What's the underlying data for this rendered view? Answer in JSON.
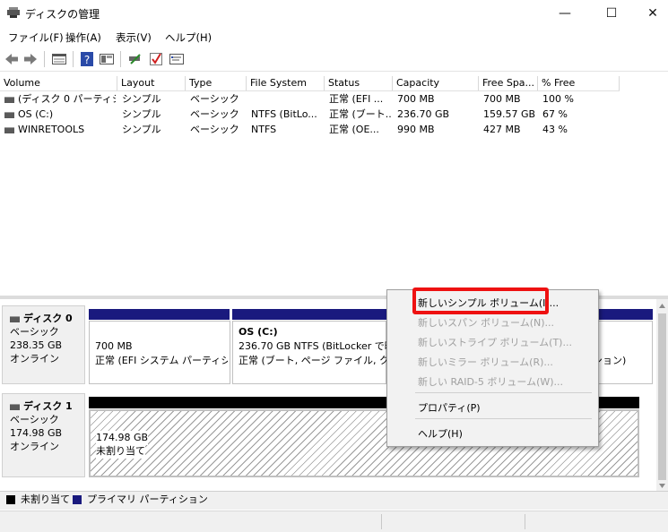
{
  "window": {
    "title": "ディスクの管理",
    "controls": {
      "minimize": "—",
      "maximize": "☐",
      "close": "✕"
    }
  },
  "menu": [
    "ファイル(F)",
    "操作(A)",
    "表示(V)",
    "ヘルプ(H)"
  ],
  "toolbar_icons": [
    "back-icon",
    "forward-icon",
    "disk-list-icon",
    "help-icon",
    "disk-view-icon",
    "connect-icon",
    "check-icon",
    "properties-icon"
  ],
  "columns": [
    "Volume",
    "Layout",
    "Type",
    "File System",
    "Status",
    "Capacity",
    "Free Spa...",
    "% Free"
  ],
  "volumes": [
    {
      "volume": "(ディスク 0 パーティシ...",
      "layout": "シンプル",
      "type": "ベーシック",
      "fs": "",
      "status": "正常 (EFI ...",
      "capacity": "700 MB",
      "free": "700 MB",
      "pct": "100 %"
    },
    {
      "volume": "OS (C:)",
      "layout": "シンプル",
      "type": "ベーシック",
      "fs": "NTFS (BitLo...",
      "status": "正常 (ブート...",
      "capacity": "236.70 GB",
      "free": "159.57 GB",
      "pct": "67 %"
    },
    {
      "volume": "WINRETOOLS",
      "layout": "シンプル",
      "type": "ベーシック",
      "fs": "NTFS",
      "status": "正常 (OE...",
      "capacity": "990 MB",
      "free": "427 MB",
      "pct": "43 %"
    }
  ],
  "disks": [
    {
      "name": "ディスク 0",
      "kind": "ベーシック",
      "size": "238.35 GB",
      "state": "オンライン",
      "partitions": [
        {
          "title": "",
          "line1": "700 MB",
          "line2": "正常 (EFI システム パーティション)"
        },
        {
          "title": "OS  (C:)",
          "line1": "236.70 GB NTFS (BitLocker で暗号化)",
          "line2": "正常 (ブート, ページ ファイル, クラッシュ ダンプ"
        },
        {
          "title": "",
          "line1": "",
          "line2": "ション)"
        }
      ]
    },
    {
      "name": "ディスク 1",
      "kind": "ベーシック",
      "size": "174.98 GB",
      "state": "オンライン",
      "partitions": [
        {
          "title": "",
          "line1": "174.98 GB",
          "line2": "未割り当て"
        }
      ]
    }
  ],
  "legend": [
    {
      "label": "未割り当て",
      "color": "#000000"
    },
    {
      "label": "プライマリ パーティション",
      "color": "#1a1a7e"
    }
  ],
  "context_menu": {
    "items": [
      {
        "label": "新しいシンプル ボリューム(I)...",
        "enabled": true,
        "highlighted": true
      },
      {
        "label": "新しいスパン ボリューム(N)...",
        "enabled": false
      },
      {
        "label": "新しいストライプ ボリューム(T)...",
        "enabled": false
      },
      {
        "label": "新しいミラー ボリューム(R)...",
        "enabled": false
      },
      {
        "label": "新しい RAID-5 ボリューム(W)...",
        "enabled": false
      },
      {
        "label": "プロパティ(P)",
        "enabled": true
      },
      {
        "label": "ヘルプ(H)",
        "enabled": true
      }
    ]
  },
  "colors": {
    "primary_partition": "#1a1a7e",
    "unallocated": "#000000",
    "highlight_box": "#ee1111"
  }
}
